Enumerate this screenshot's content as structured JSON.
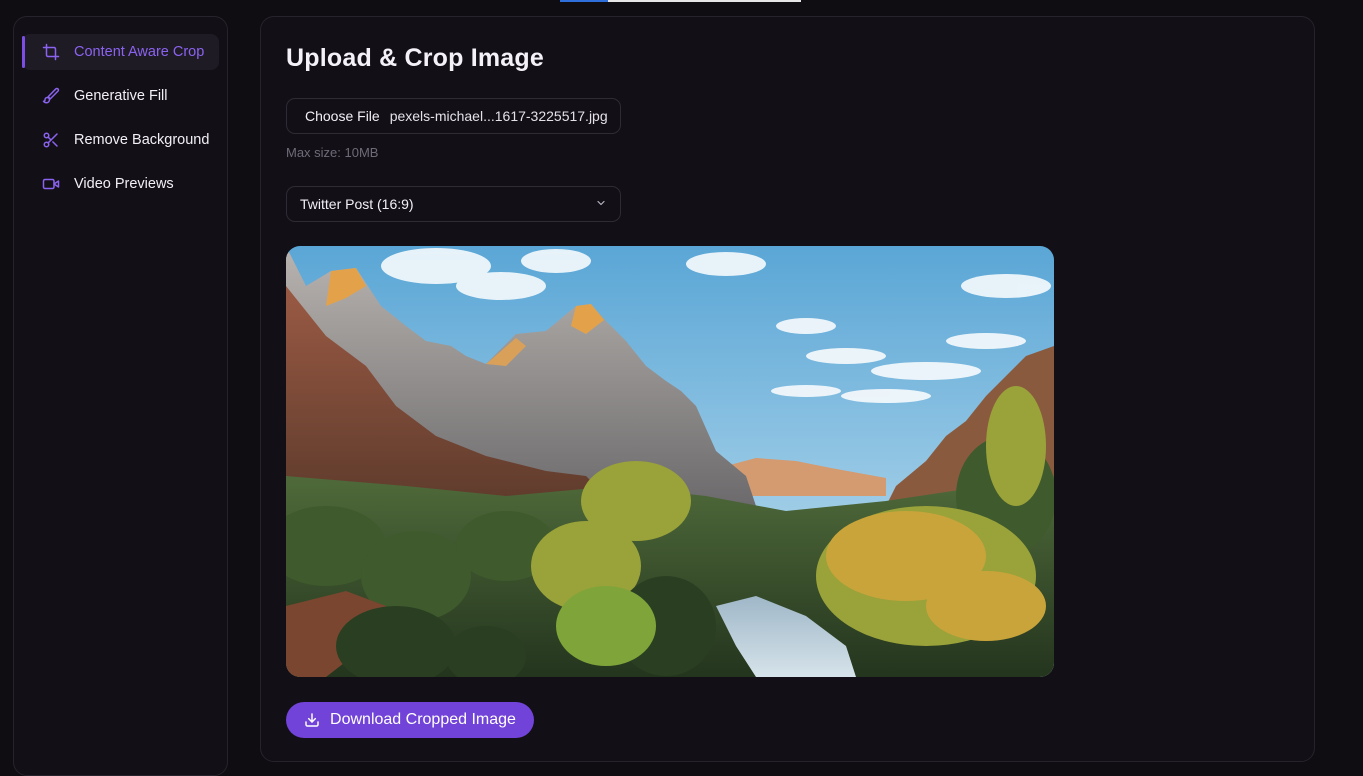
{
  "top_progress": {
    "value": 0.2
  },
  "sidebar": {
    "items": [
      {
        "label": "Content Aware Crop",
        "icon": "crop-icon",
        "active": true
      },
      {
        "label": "Generative Fill",
        "icon": "brush-icon",
        "active": false
      },
      {
        "label": "Remove Background",
        "icon": "scissors-icon",
        "active": false
      },
      {
        "label": "Video Previews",
        "icon": "video-icon",
        "active": false
      }
    ]
  },
  "main": {
    "title": "Upload & Crop Image",
    "file_input": {
      "button_label": "Choose File",
      "file_name": "pexels-michael...1617-3225517.jpg"
    },
    "max_size_hint": "Max size: 10MB",
    "aspect_select": {
      "selected": "Twitter Post (16:9)"
    },
    "preview": {
      "subject": "mountain-landscape-image"
    },
    "download_button": {
      "label": "Download Cropped Image",
      "icon": "download-icon"
    }
  },
  "colors": {
    "accent": "#7243d8",
    "accent_text": "#8b63f0",
    "background": "#0f0d12",
    "panel": "#121016"
  }
}
